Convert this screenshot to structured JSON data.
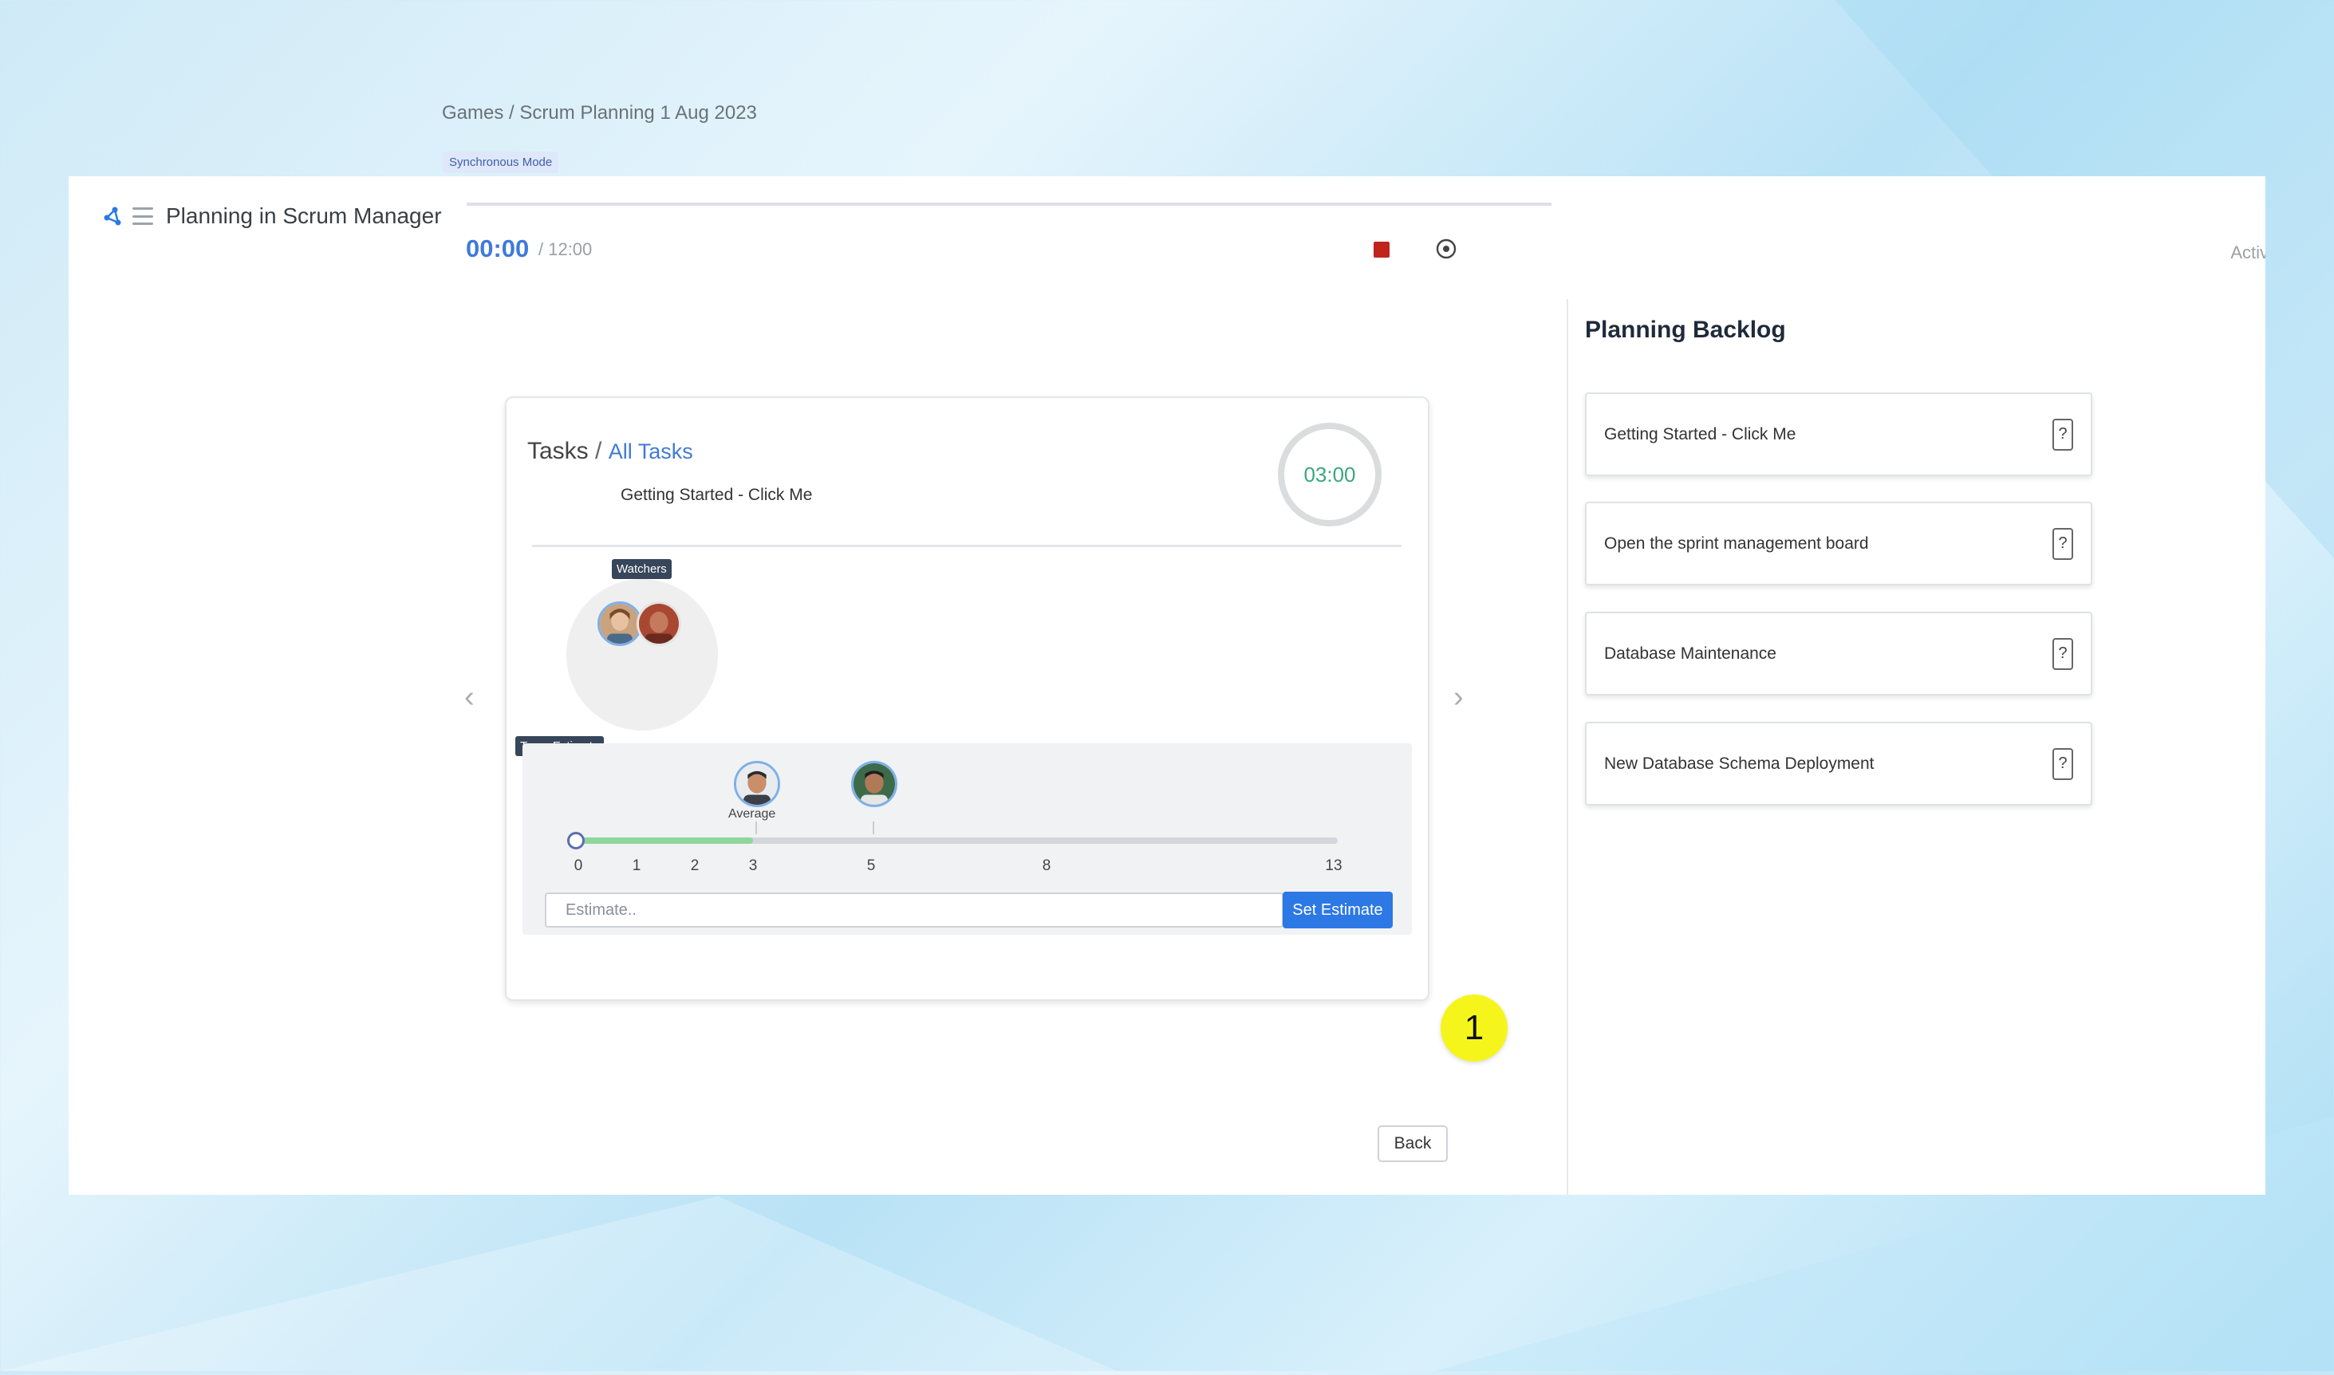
{
  "app": {
    "title": "Planning in Scrum Manager",
    "activity_label": "Activ"
  },
  "breadcrumb": "Games / Scrum Planning 1 Aug 2023",
  "mode_badge": "Synchronous Mode",
  "timer": {
    "elapsed": "00:00",
    "total": "/ 12:00"
  },
  "task_card": {
    "heading": "Tasks",
    "separator": "/",
    "all_tasks_link": "All Tasks",
    "task_name": "Getting Started - Click Me",
    "countdown": "03:00",
    "watchers_tag": "Watchers",
    "team_estimate_tag": "Team Estimate",
    "average_label": "Average",
    "scale": [
      "0",
      "1",
      "2",
      "3",
      "5",
      "8",
      "13"
    ],
    "slider_value": 3,
    "estimate_placeholder": "Estimate..",
    "set_estimate_label": "Set Estimate",
    "back_label": "Back",
    "nav_prev": "‹",
    "nav_next": "›"
  },
  "step_badge": "1",
  "backlog": {
    "title": "Planning Backlog",
    "items": [
      {
        "label": "Getting Started - Click Me",
        "icon": "?"
      },
      {
        "label": "Open the sprint management board",
        "icon": "?"
      },
      {
        "label": "Database Maintenance",
        "icon": "?"
      },
      {
        "label": "New Database Schema Deployment",
        "icon": "?"
      }
    ]
  },
  "colors": {
    "accent": "#3f7ad8",
    "stop": "#c0241c",
    "timer_green": "#3aa77a",
    "badge_yellow": "#f6f51b",
    "button_blue": "#2c78e4"
  }
}
